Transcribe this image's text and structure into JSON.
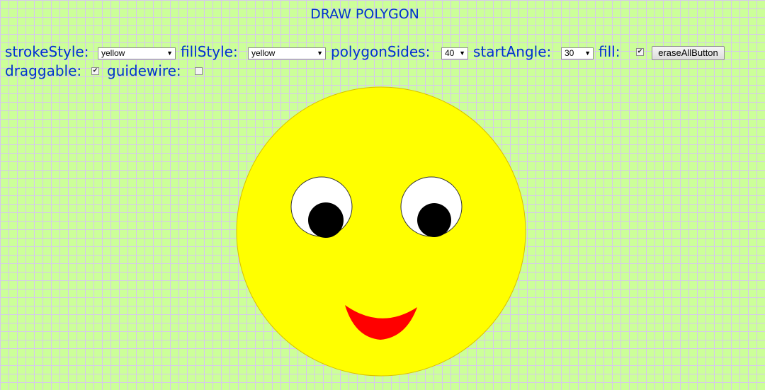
{
  "title": "DRAW POLYGON",
  "controls": {
    "stroke_style_label": "strokeStyle:",
    "stroke_style_value": "yellow",
    "fill_style_label": "fillStyle:",
    "fill_style_value": "yellow",
    "polygon_sides_label": "polygonSides:",
    "polygon_sides_value": "40",
    "start_angle_label": "startAngle:",
    "start_angle_value": "30",
    "fill_label": "fill:",
    "fill_checked": true,
    "erase_button_label": "eraseAllButton",
    "draggable_label": "draggable:",
    "draggable_checked": true,
    "guidewire_label": "guidewire:",
    "guidewire_checked": false
  },
  "drawing": {
    "face_color": "#ffff00",
    "eye_white_color": "#ffffff",
    "pupil_color": "#000000",
    "mouth_color": "#ff0000"
  }
}
